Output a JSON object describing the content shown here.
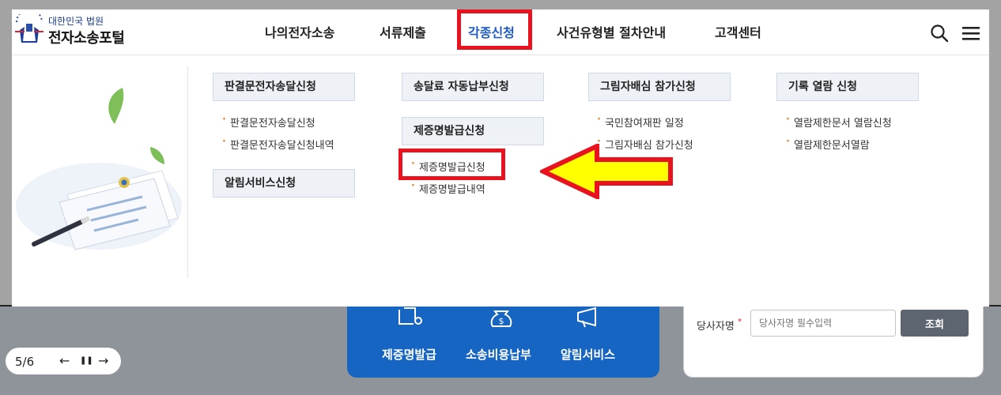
{
  "logo": {
    "small": "대한민국 법원",
    "big": "전자소송포털"
  },
  "gnb": [
    "나의전자소송",
    "서류제출",
    "각종신청",
    "사건유형별 절차안내",
    "고객센터"
  ],
  "active_gnb": "각종신청",
  "icons": {
    "search": "search-icon",
    "menu": "hamburger-menu-icon"
  },
  "columns": [
    {
      "groups": [
        {
          "title": "판결문전자송달신청",
          "items": [
            "판결문전자송달신청",
            "판결문전자송달신청내역"
          ]
        },
        {
          "title": "알림서비스신청",
          "items": []
        }
      ]
    },
    {
      "groups": [
        {
          "title": "송달료 자동납부신청",
          "items": []
        },
        {
          "title": "제증명발급신청",
          "items": [
            "제증명발급신청",
            "제증명발급내역"
          ]
        }
      ]
    },
    {
      "groups": [
        {
          "title": "그림자배심 참가신청",
          "items": [
            "국민참여재판 일정",
            "그림자배심 참가신청"
          ]
        }
      ]
    },
    {
      "groups": [
        {
          "title": "기록 열람 신청",
          "items": [
            "열람제한문서 열람신청",
            "열람제한문서열람"
          ]
        }
      ]
    }
  ],
  "highlight": {
    "item": "제증명발급신청",
    "box_color": "#e8131f",
    "arrow_fill": "#ffff00"
  },
  "blue_card": {
    "items": [
      "제증명발급",
      "소송비용납부",
      "알림서비스"
    ],
    "color": "#1665c2"
  },
  "search_form": {
    "label": "당사자명",
    "placeholder": "당사자명 필수입력",
    "button": "조회"
  },
  "pager": {
    "count": "5/6",
    "prev": "←",
    "pause": "❚❚",
    "next": "→"
  }
}
